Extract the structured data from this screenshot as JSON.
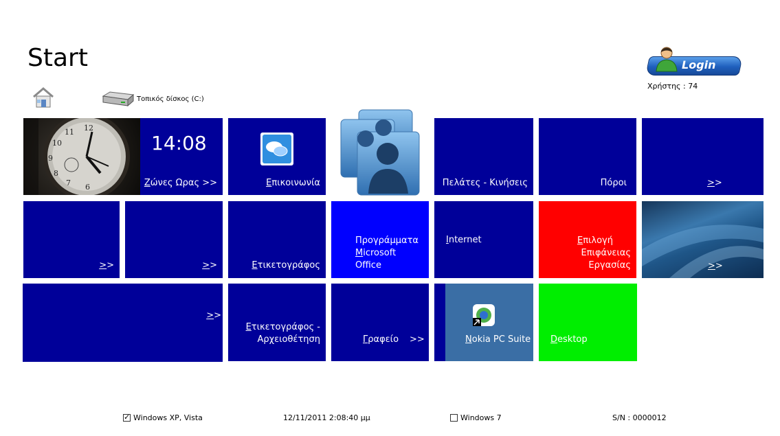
{
  "header": {
    "title": "Start"
  },
  "login": {
    "label": "Login",
    "user_label": "Χρήστης : 74"
  },
  "toolbar": {
    "disk_label": "Τοπικός δίσκος (C:)"
  },
  "tiles": {
    "clock": {
      "time": "14:08",
      "label": "Ζώνες Ωρας >>"
    },
    "communication": {
      "label": "Επικοινωνία"
    },
    "customers": {
      "label": "Πελάτες - Κινήσεις"
    },
    "resources": {
      "label": "Πόροι"
    },
    "more1": {
      "label": ">>"
    },
    "more2": {
      "label": ">>"
    },
    "more3": {
      "label": ">>"
    },
    "labeler": {
      "label": "Ετικετογράφος"
    },
    "office": {
      "line1": "Προγράμματα",
      "line2": "Microsoft",
      "line3": "Office"
    },
    "internet": {
      "label": "Internet"
    },
    "desktop_choice": {
      "line1": "Επιλογή",
      "line2": "Επιφάνειας",
      "line3": "Εργασίας"
    },
    "wallpaper": {
      "label": ">>"
    },
    "more4": {
      "label": ">>"
    },
    "labeler_archive": {
      "line1": "Ετικετογράφος -",
      "line2": "Αρχειοθέτηση"
    },
    "desk": {
      "label": "Γραφείο",
      "arrow": ">>"
    },
    "nokia": {
      "label": "Nokia PC Suite"
    },
    "desktop": {
      "label": "Desktop"
    }
  },
  "footer": {
    "os_xp": "Windows XP, Vista",
    "datetime": "12/11/2011 2:08:40 μμ",
    "os_7": "Windows 7",
    "serial": "S/N : 0000012"
  },
  "colors": {
    "navy": "#000099",
    "blue": "#0000ff",
    "red": "#ff0000",
    "green": "#00ee00",
    "steel": "#3a6ea5"
  }
}
